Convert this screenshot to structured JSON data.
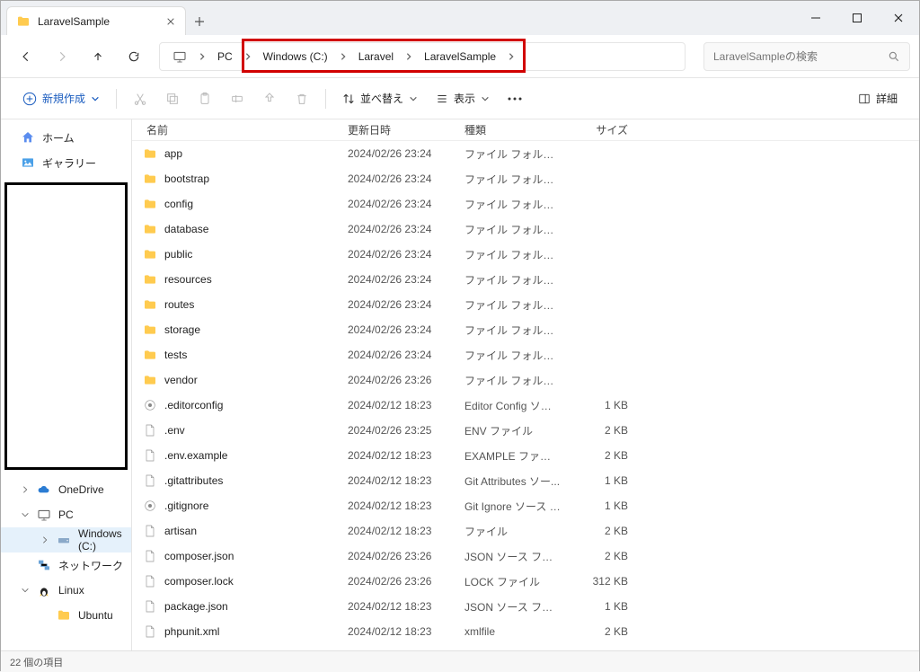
{
  "window": {
    "title": "LaravelSample"
  },
  "breadcrumb": {
    "pc": "PC",
    "parts": [
      "Windows (C:)",
      "Laravel",
      "LaravelSample"
    ]
  },
  "search": {
    "placeholder": "LaravelSampleの検索"
  },
  "toolbar": {
    "new_label": "新規作成",
    "sort_label": "並べ替え",
    "view_label": "表示",
    "detail_label": "詳細"
  },
  "sidebar": {
    "home": "ホーム",
    "gallery": "ギャラリー",
    "onedrive": "OneDrive",
    "pc": "PC",
    "windows_c": "Windows (C:)",
    "network": "ネットワーク",
    "linux": "Linux",
    "ubuntu": "Ubuntu"
  },
  "columns": {
    "name": "名前",
    "date": "更新日時",
    "type": "種類",
    "size": "サイズ"
  },
  "files": [
    {
      "icon": "folder",
      "name": "app",
      "date": "2024/02/26 23:24",
      "type": "ファイル フォルダー",
      "size": ""
    },
    {
      "icon": "folder",
      "name": "bootstrap",
      "date": "2024/02/26 23:24",
      "type": "ファイル フォルダー",
      "size": ""
    },
    {
      "icon": "folder",
      "name": "config",
      "date": "2024/02/26 23:24",
      "type": "ファイル フォルダー",
      "size": ""
    },
    {
      "icon": "folder",
      "name": "database",
      "date": "2024/02/26 23:24",
      "type": "ファイル フォルダー",
      "size": ""
    },
    {
      "icon": "folder",
      "name": "public",
      "date": "2024/02/26 23:24",
      "type": "ファイル フォルダー",
      "size": ""
    },
    {
      "icon": "folder",
      "name": "resources",
      "date": "2024/02/26 23:24",
      "type": "ファイル フォルダー",
      "size": ""
    },
    {
      "icon": "folder",
      "name": "routes",
      "date": "2024/02/26 23:24",
      "type": "ファイル フォルダー",
      "size": ""
    },
    {
      "icon": "folder",
      "name": "storage",
      "date": "2024/02/26 23:24",
      "type": "ファイル フォルダー",
      "size": ""
    },
    {
      "icon": "folder",
      "name": "tests",
      "date": "2024/02/26 23:24",
      "type": "ファイル フォルダー",
      "size": ""
    },
    {
      "icon": "folder",
      "name": "vendor",
      "date": "2024/02/26 23:26",
      "type": "ファイル フォルダー",
      "size": ""
    },
    {
      "icon": "gear",
      "name": ".editorconfig",
      "date": "2024/02/12 18:23",
      "type": "Editor Config ソース...",
      "size": "1 KB"
    },
    {
      "icon": "file",
      "name": ".env",
      "date": "2024/02/26 23:25",
      "type": "ENV ファイル",
      "size": "2 KB"
    },
    {
      "icon": "file",
      "name": ".env.example",
      "date": "2024/02/12 18:23",
      "type": "EXAMPLE ファイル",
      "size": "2 KB"
    },
    {
      "icon": "file",
      "name": ".gitattributes",
      "date": "2024/02/12 18:23",
      "type": "Git Attributes ソー...",
      "size": "1 KB"
    },
    {
      "icon": "gear",
      "name": ".gitignore",
      "date": "2024/02/12 18:23",
      "type": "Git Ignore ソース フ...",
      "size": "1 KB"
    },
    {
      "icon": "file",
      "name": "artisan",
      "date": "2024/02/12 18:23",
      "type": "ファイル",
      "size": "2 KB"
    },
    {
      "icon": "file",
      "name": "composer.json",
      "date": "2024/02/26 23:26",
      "type": "JSON ソース ファイル",
      "size": "2 KB"
    },
    {
      "icon": "file",
      "name": "composer.lock",
      "date": "2024/02/26 23:26",
      "type": "LOCK ファイル",
      "size": "312 KB"
    },
    {
      "icon": "file",
      "name": "package.json",
      "date": "2024/02/12 18:23",
      "type": "JSON ソース ファイル",
      "size": "1 KB"
    },
    {
      "icon": "file",
      "name": "phpunit.xml",
      "date": "2024/02/12 18:23",
      "type": "xmlfile",
      "size": "2 KB"
    }
  ],
  "status": {
    "count": "22 個の項目"
  }
}
